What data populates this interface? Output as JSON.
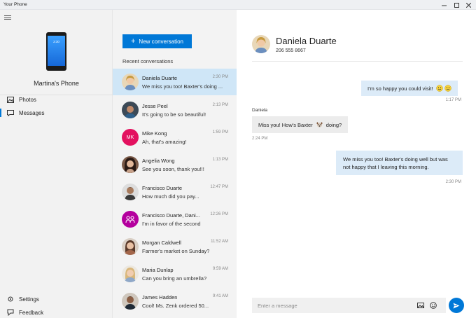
{
  "window": {
    "title": "Your Phone"
  },
  "nav": {
    "phone_name": "Martina's Phone",
    "phone_screen_time": "2:30",
    "items": [
      {
        "label": "Photos",
        "icon": "photos-icon"
      },
      {
        "label": "Messages",
        "icon": "messages-icon",
        "active": true
      }
    ],
    "bottom": [
      {
        "label": "Settings",
        "icon": "gear-icon"
      },
      {
        "label": "Feedback",
        "icon": "feedback-icon"
      }
    ]
  },
  "conversations": {
    "new_label": "New conversation",
    "recent_label": "Recent conversations",
    "items": [
      {
        "name": "Daniela Duarte",
        "time": "2:30 PM",
        "preview": "We miss you too! Baxter's doing ...",
        "selected": true
      },
      {
        "name": "Jesse Peel",
        "time": "2:13 PM",
        "preview": "It's going to be so beautiful!"
      },
      {
        "name": "Mike Kong",
        "time": "1:59 PM",
        "preview": "Ah, that's amazing!",
        "initials": "MK"
      },
      {
        "name": "Angelia Wong",
        "time": "1:13 PM",
        "preview": "See you soon, thank you!!!"
      },
      {
        "name": "Francisco Duarte",
        "time": "12:47 PM",
        "preview": "How much did you pay..."
      },
      {
        "name": "Francisco Duarte, Dani...",
        "time": "12:26 PM",
        "preview": "I'm in favor of the second"
      },
      {
        "name": "Morgan Caldwell",
        "time": "11:52 AM",
        "preview": "Farmer's market on Sunday?"
      },
      {
        "name": "Maria Dunlap",
        "time": "9:59 AM",
        "preview": "Can you bring an umbrella?"
      },
      {
        "name": "James Hadden",
        "time": "9:41 AM",
        "preview": "Cool! Ms. Zenk ordered 50..."
      }
    ]
  },
  "chat": {
    "contact_name": "Daniela Duarte",
    "contact_phone": "206 555 8667",
    "messages": [
      {
        "direction": "out",
        "text": "I'm so happy you could visit!",
        "time": "1:17 PM"
      },
      {
        "direction": "in",
        "sender": "Daniela",
        "text_before": "Miss you! How's Baxter",
        "text_after": "doing?",
        "time": "2:24 PM"
      },
      {
        "direction": "out",
        "text": "We miss you too! Baxter's doing well but was not happy that I leaving this morning.",
        "time": "2:30 PM"
      }
    ],
    "composer_placeholder": "Enter a message"
  },
  "colors": {
    "accent": "#0078d7",
    "selected_row": "#cfe6f7",
    "outgoing_bubble": "#dcebf8",
    "incoming_bubble": "#ececec"
  }
}
